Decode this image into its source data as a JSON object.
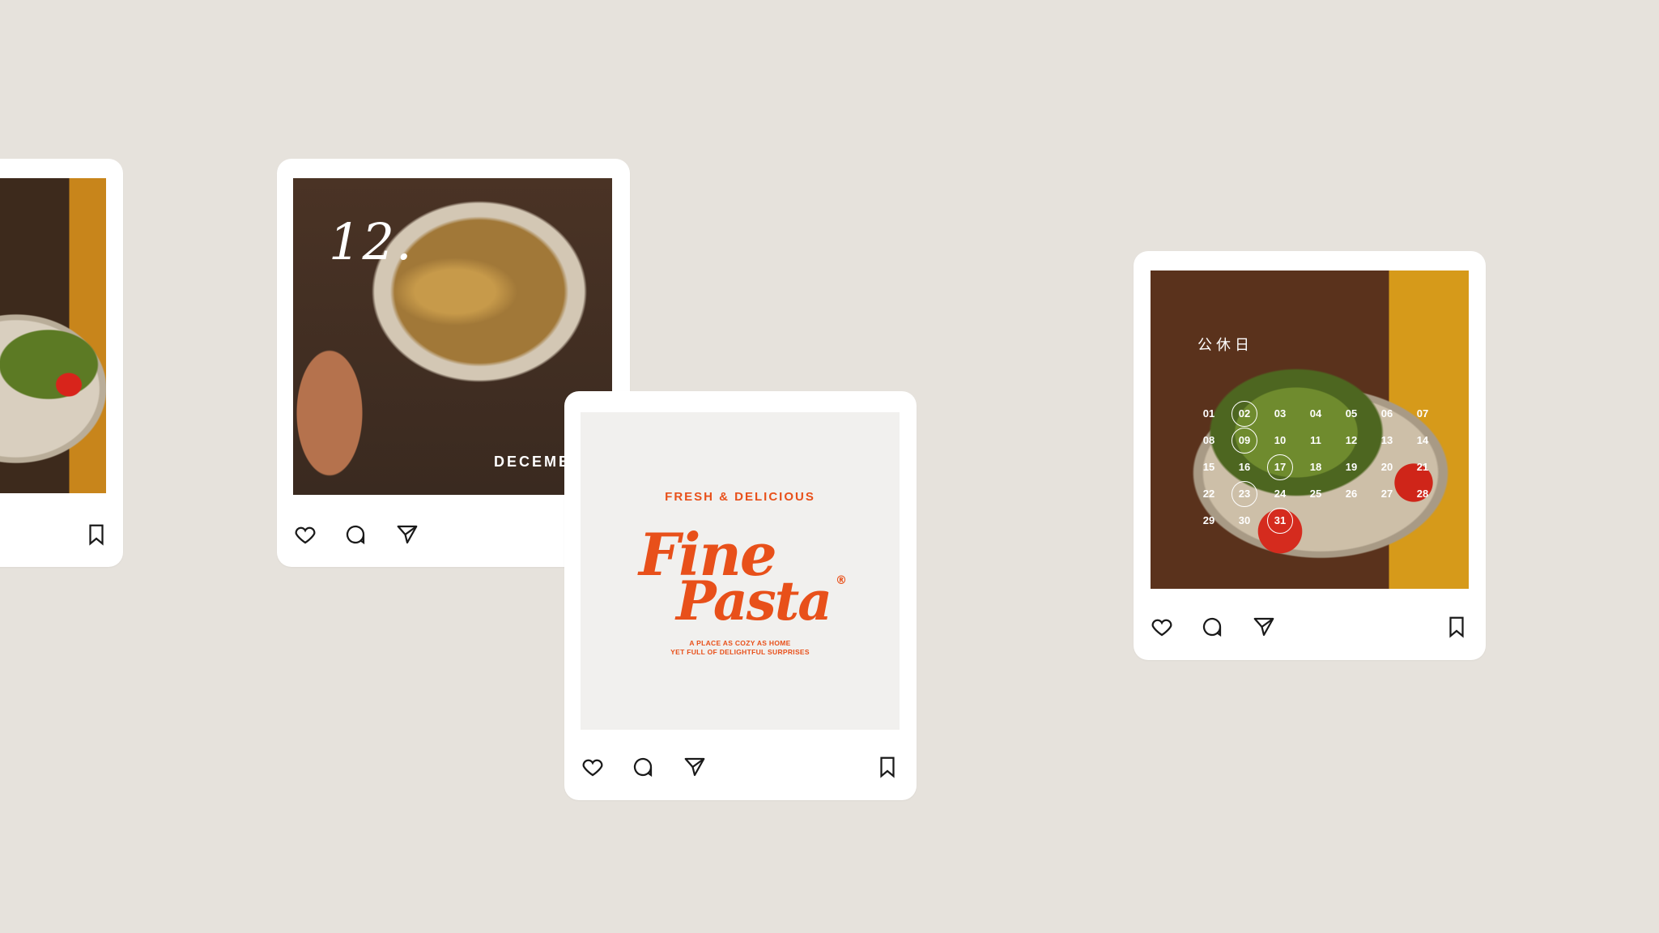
{
  "card_left": {
    "actions": {
      "bookmark_icon": "bookmark-icon"
    }
  },
  "card_december": {
    "day": "12.",
    "month": "DECEMB",
    "actions": {
      "like_icon": "heart-icon",
      "comment_icon": "comment-icon",
      "share_icon": "send-icon"
    }
  },
  "card_logo": {
    "tagline_top": "FRESH & DELICIOUS",
    "brand_line1": "Fine",
    "brand_line2": "Pasta",
    "registered": "®",
    "tagline_line1": "A PLACE AS COZY AS HOME",
    "tagline_line2": "YET FULL OF DELIGHTFUL SURPRISES",
    "brand_color": "#e8501a",
    "actions": {
      "like_icon": "heart-icon",
      "comment_icon": "comment-icon",
      "share_icon": "send-icon",
      "bookmark_icon": "bookmark-icon"
    }
  },
  "card_calendar": {
    "title": "公休日",
    "days": [
      {
        "label": "01",
        "circled": false
      },
      {
        "label": "02",
        "circled": true
      },
      {
        "label": "03",
        "circled": false
      },
      {
        "label": "04",
        "circled": false
      },
      {
        "label": "05",
        "circled": false
      },
      {
        "label": "06",
        "circled": false
      },
      {
        "label": "07",
        "circled": false
      },
      {
        "label": "08",
        "circled": false
      },
      {
        "label": "09",
        "circled": true
      },
      {
        "label": "10",
        "circled": false
      },
      {
        "label": "11",
        "circled": false
      },
      {
        "label": "12",
        "circled": false
      },
      {
        "label": "13",
        "circled": false
      },
      {
        "label": "14",
        "circled": false
      },
      {
        "label": "15",
        "circled": false
      },
      {
        "label": "16",
        "circled": false
      },
      {
        "label": "17",
        "circled": true
      },
      {
        "label": "18",
        "circled": false
      },
      {
        "label": "19",
        "circled": false
      },
      {
        "label": "20",
        "circled": false
      },
      {
        "label": "21",
        "circled": false
      },
      {
        "label": "22",
        "circled": false
      },
      {
        "label": "23",
        "circled": true
      },
      {
        "label": "24",
        "circled": false
      },
      {
        "label": "25",
        "circled": false
      },
      {
        "label": "26",
        "circled": false
      },
      {
        "label": "27",
        "circled": false
      },
      {
        "label": "28",
        "circled": false
      },
      {
        "label": "29",
        "circled": false
      },
      {
        "label": "30",
        "circled": false
      },
      {
        "label": "31",
        "circled": true
      }
    ],
    "actions": {
      "like_icon": "heart-icon",
      "comment_icon": "comment-icon",
      "share_icon": "send-icon",
      "bookmark_icon": "bookmark-icon"
    }
  }
}
